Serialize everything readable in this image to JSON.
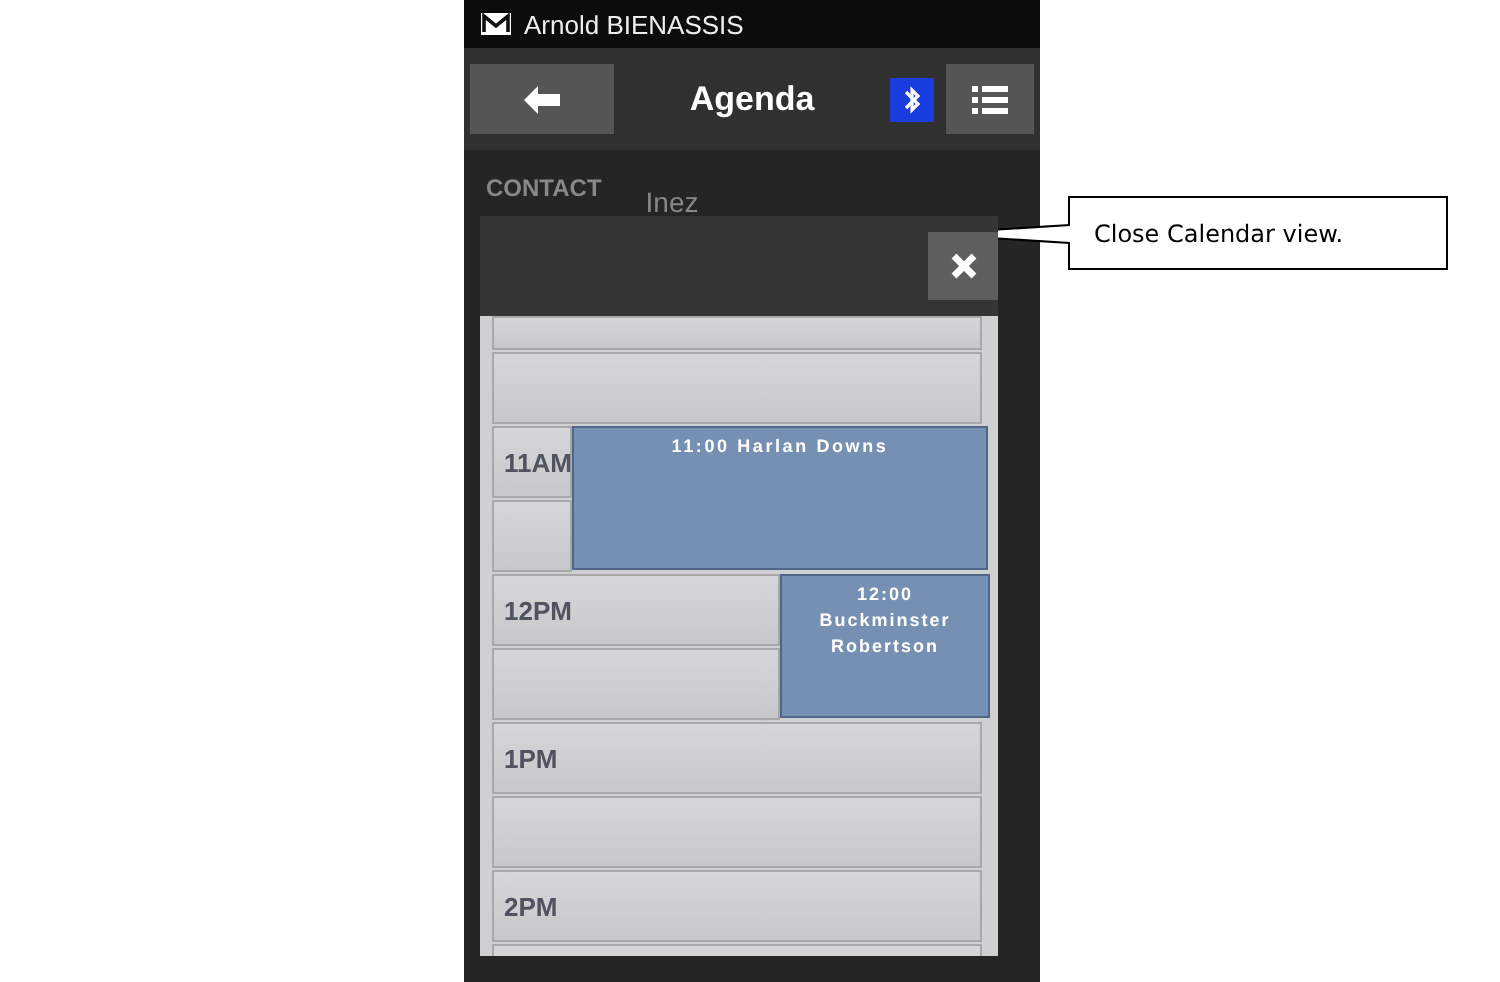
{
  "status_bar": {
    "title": "Arnold BIENASSIS"
  },
  "header": {
    "title": "Agenda"
  },
  "form": {
    "label": "CONTACT",
    "value": "Inez"
  },
  "calendar": {
    "hours": [
      {
        "label": "11AM",
        "events": [
          {
            "kind": "wide",
            "time": "11:00",
            "name": "Harlan Downs"
          }
        ]
      },
      {
        "label": "12PM",
        "events": [
          {
            "kind": "narrow",
            "time": "12:00",
            "name": "Buckminster Robertson"
          }
        ]
      },
      {
        "label": "1PM"
      },
      {
        "label": "2PM"
      }
    ]
  },
  "callout": {
    "text": "Close Calendar view."
  }
}
